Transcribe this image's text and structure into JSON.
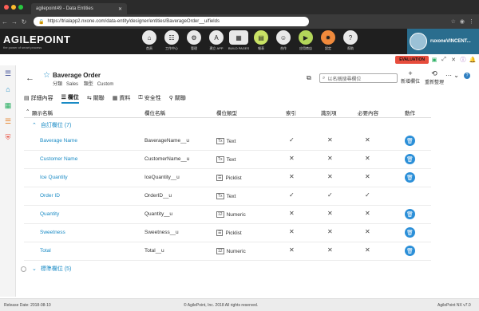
{
  "browser": {
    "tab_title": "agilepoint49 - Data Entities",
    "url": "https://trialapp2.nxone.com/data-entity/designer/entities/BaverageOrder__u/fields"
  },
  "header": {
    "logo": "AGILEPOINT",
    "tagline": "the power of smart process",
    "modules": [
      {
        "label": "首頁",
        "icon": "home-icon"
      },
      {
        "label": "工作中心",
        "icon": "workcenter-icon"
      },
      {
        "label": "管理",
        "icon": "manage-icon"
      },
      {
        "label": "建立 APP",
        "icon": "build-app-icon"
      },
      {
        "label": "BUILD PAGES",
        "icon": "build-pages-icon"
      },
      {
        "label": "報表",
        "icon": "report-icon"
      },
      {
        "label": "合作",
        "icon": "collaborate-icon"
      },
      {
        "label": "应用商店",
        "icon": "app-store-icon"
      },
      {
        "label": "設定",
        "icon": "settings-icon"
      },
      {
        "label": "幫助",
        "icon": "help-icon"
      }
    ],
    "username": "ruxoneVINCENT...",
    "evaluation": "EVALUATION",
    "notification_count": "10"
  },
  "entity": {
    "name": "Baverage Order",
    "category_label": "分類",
    "category": "Sales",
    "type_label": "類型",
    "type": "Custom",
    "search_placeholder": "以名稱搜尋欄位",
    "new_field": "新增欄位",
    "reorder": "重新整理"
  },
  "subtabs": [
    {
      "label": "詳細內容",
      "icon": "details-icon"
    },
    {
      "label": "欄位",
      "icon": "fields-icon"
    },
    {
      "label": "關聯",
      "icon": "relations-icon"
    },
    {
      "label": "資料",
      "icon": "data-icon"
    },
    {
      "label": "安全性",
      "icon": "security-icon"
    },
    {
      "label": "關聯",
      "icon": "link-icon"
    }
  ],
  "table": {
    "headers": {
      "display_name": "顯示名稱",
      "field_name": "欄位名稱",
      "field_type": "欄位類型",
      "index": "索引",
      "identifier": "識別項",
      "required": "必要內容",
      "actions": "動作"
    },
    "custom_group": "自訂欄位 (7)",
    "standard_group": "標準欄位 (5)",
    "rows": [
      {
        "display": "Baverage Name",
        "field": "BaverageName__u",
        "type": "Text",
        "type_icon": "text-icon",
        "index": "✓",
        "ident": "✕",
        "req": "✕",
        "deletable": true
      },
      {
        "display": "Customer Name",
        "field": "CustomerName__u",
        "type": "Text",
        "type_icon": "text-icon",
        "index": "✕",
        "ident": "✕",
        "req": "✕",
        "deletable": true
      },
      {
        "display": "Ice Quantity",
        "field": "IceQuantity__u",
        "type": "Picklist",
        "type_icon": "picklist-icon",
        "index": "✕",
        "ident": "✕",
        "req": "✕",
        "deletable": true
      },
      {
        "display": "Order ID",
        "field": "OrderID__u",
        "type": "Text",
        "type_icon": "text-icon",
        "index": "✓",
        "ident": "✓",
        "req": "✓",
        "deletable": false
      },
      {
        "display": "Quantity",
        "field": "Quantity__u",
        "type": "Numeric",
        "type_icon": "numeric-icon",
        "index": "✕",
        "ident": "✕",
        "req": "✕",
        "deletable": true
      },
      {
        "display": "Sweetness",
        "field": "Sweetness__u",
        "type": "Picklist",
        "type_icon": "picklist-icon",
        "index": "✕",
        "ident": "✕",
        "req": "✕",
        "deletable": true
      },
      {
        "display": "Total",
        "field": "Total__u",
        "type": "Numeric",
        "type_icon": "numeric-icon",
        "index": "✕",
        "ident": "✕",
        "req": "✕",
        "deletable": true
      }
    ]
  },
  "footer": {
    "release": "Release Date: 2018-08-10",
    "copyright": "© AgilePoint, Inc. 2018 All rights reserved.",
    "version": "AgilePoint NX v7.0"
  },
  "colors": {
    "accent": "#1a8bc5",
    "header_bg": "#1f1f1f",
    "user_bg": "#2a6d8e",
    "evaluation": "#e74c3c",
    "trash": "#2b8fd8"
  }
}
